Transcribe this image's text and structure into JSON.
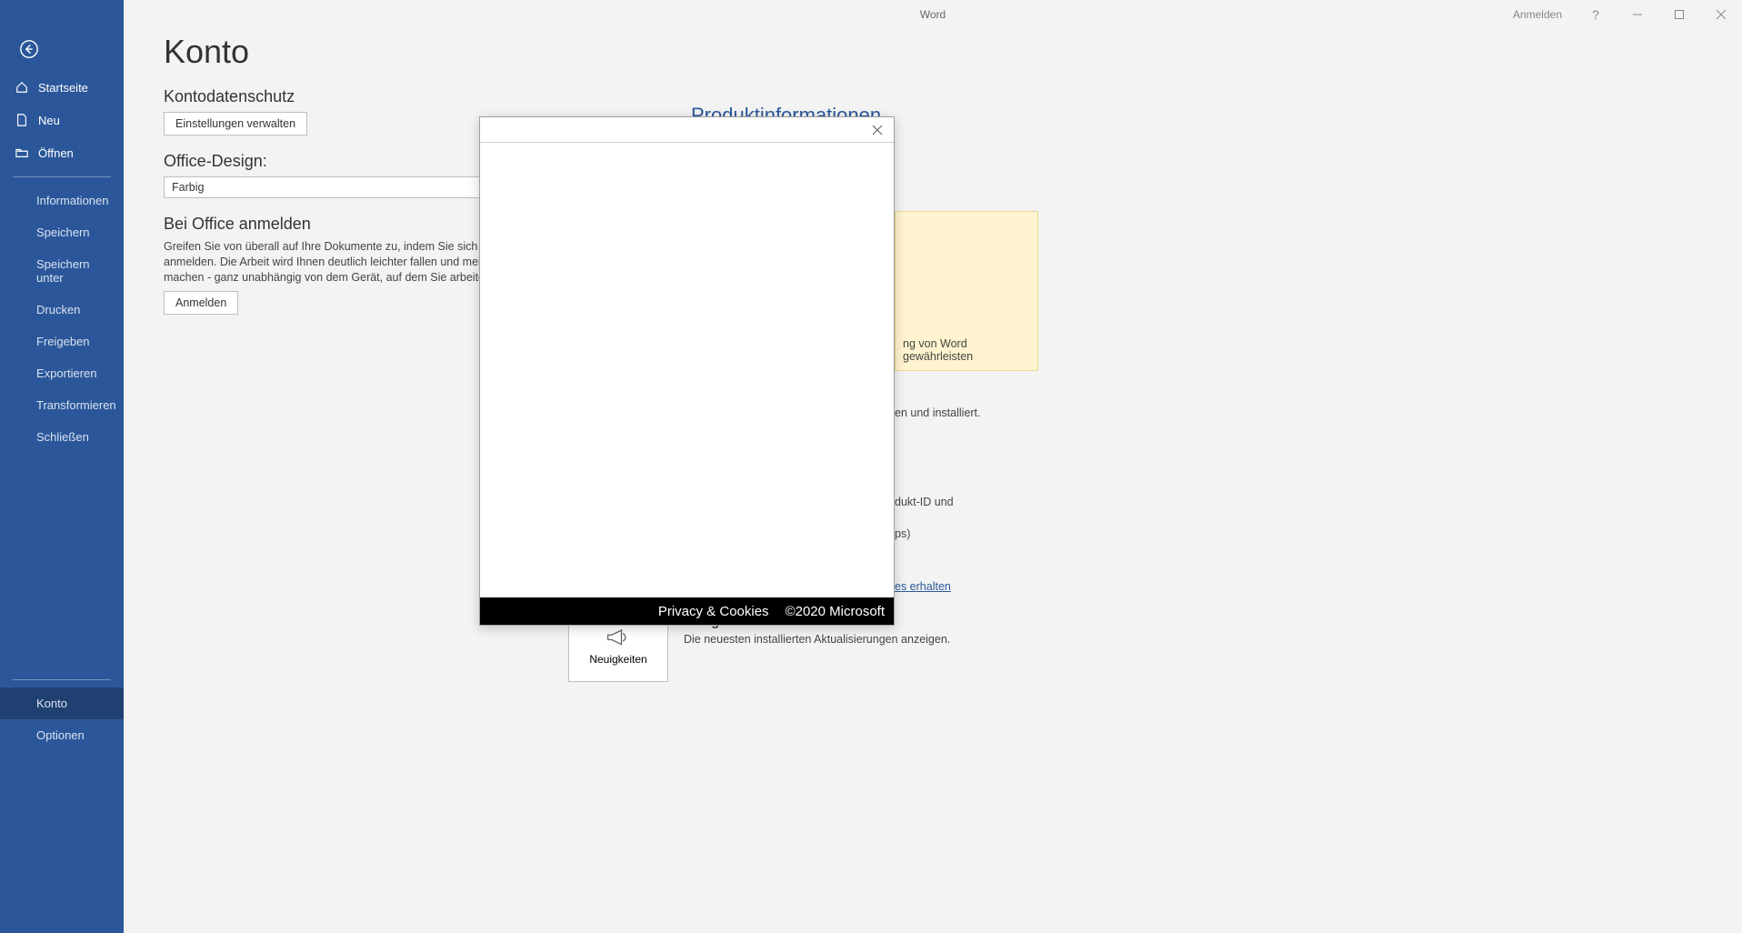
{
  "titlebar": {
    "app": "Word",
    "signin": "Anmelden"
  },
  "sidebar": {
    "top": [
      {
        "label": "Startseite",
        "icon": "home"
      },
      {
        "label": "Neu",
        "icon": "new"
      },
      {
        "label": "Öffnen",
        "icon": "open"
      }
    ],
    "mid": [
      {
        "label": "Informationen"
      },
      {
        "label": "Speichern"
      },
      {
        "label": "Speichern unter"
      },
      {
        "label": "Drucken"
      },
      {
        "label": "Freigeben"
      },
      {
        "label": "Exportieren"
      },
      {
        "label": "Transformieren"
      },
      {
        "label": "Schließen"
      }
    ],
    "bottom": [
      {
        "label": "Konto",
        "active": true
      },
      {
        "label": "Optionen"
      }
    ]
  },
  "main": {
    "title": "Konto",
    "privacy_h": "Kontodatenschutz",
    "privacy_btn": "Einstellungen verwalten",
    "theme_h": "Office-Design:",
    "theme_value": "Farbig",
    "signin_h": "Bei Office anmelden",
    "signin_desc": "Greifen Sie von überall auf Ihre Dokumente zu, indem Sie sich bei Office anmelden. Die Arbeit wird Ihnen deutlich leichter fallen und mehr Spaß machen - ganz unabhängig von dem Gerät, auf dem Sie arbeiten.",
    "signin_btn": "Anmelden"
  },
  "right": {
    "title": "Produktinformationen",
    "yellow_tail": "ng von Word gewährleisten",
    "frag1": "en und installiert.",
    "frag2": "dukt-ID und",
    "frag3": "ps)",
    "link_tail": "es erhalten"
  },
  "whatsnew": {
    "button": "Neuigkeiten",
    "title": "Neuigkeiten",
    "desc": "Die neuesten installierten Aktualisierungen anzeigen."
  },
  "modal": {
    "footer_privacy": "Privacy & Cookies",
    "footer_copy": "©2020 Microsoft"
  }
}
